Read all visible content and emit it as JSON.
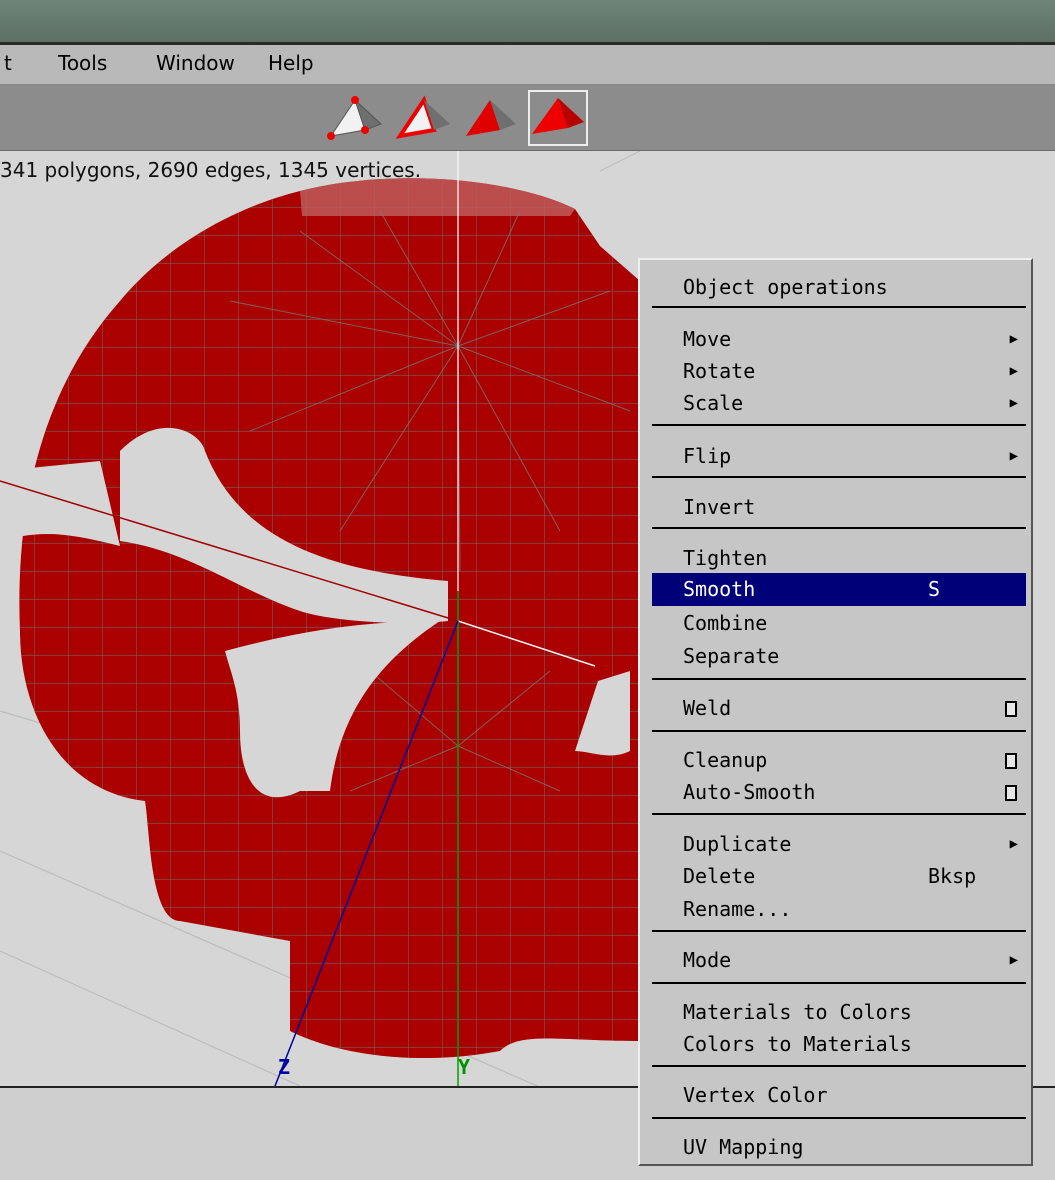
{
  "menubar": {
    "items": [
      "t",
      "Tools",
      "Window",
      "Help"
    ]
  },
  "toolbar": {
    "buttons": [
      "wireframe-icon",
      "outline-icon",
      "flat-shaded-icon",
      "smooth-shaded-icon"
    ],
    "active": "smooth-shaded-icon"
  },
  "status": {
    "info": "341 polygons, 2690 edges, 1345 vertices."
  },
  "axes": {
    "z_label": "Z",
    "y_label": "Y"
  },
  "colors": {
    "mesh": "#aa0000",
    "highlight": "#000078",
    "x_axis": "#a00000",
    "y_axis": "#00a000",
    "z_axis": "#0000a0"
  },
  "context_menu": {
    "title": "Object operations",
    "items": {
      "move": {
        "label": "Move",
        "submenu": true
      },
      "rotate": {
        "label": "Rotate",
        "submenu": true
      },
      "scale": {
        "label": "Scale",
        "submenu": true
      },
      "flip": {
        "label": "Flip",
        "submenu": true
      },
      "invert": {
        "label": "Invert"
      },
      "tighten": {
        "label": "Tighten"
      },
      "smooth": {
        "label": "Smooth",
        "shortcut": "S",
        "highlighted": true
      },
      "combine": {
        "label": "Combine"
      },
      "separate": {
        "label": "Separate"
      },
      "weld": {
        "label": "Weld",
        "option": true
      },
      "cleanup": {
        "label": "Cleanup",
        "option": true
      },
      "auto_smooth": {
        "label": "Auto-Smooth",
        "option": true
      },
      "duplicate": {
        "label": "Duplicate",
        "submenu": true
      },
      "delete": {
        "label": "Delete",
        "shortcut": "Bksp"
      },
      "rename": {
        "label": "Rename..."
      },
      "mode": {
        "label": "Mode",
        "submenu": true
      },
      "materials_to_colors": {
        "label": "Materials to Colors"
      },
      "colors_to_materials": {
        "label": "Colors to Materials"
      },
      "vertex_color": {
        "label": "Vertex Color"
      },
      "uv_mapping": {
        "label": "UV Mapping"
      }
    }
  }
}
